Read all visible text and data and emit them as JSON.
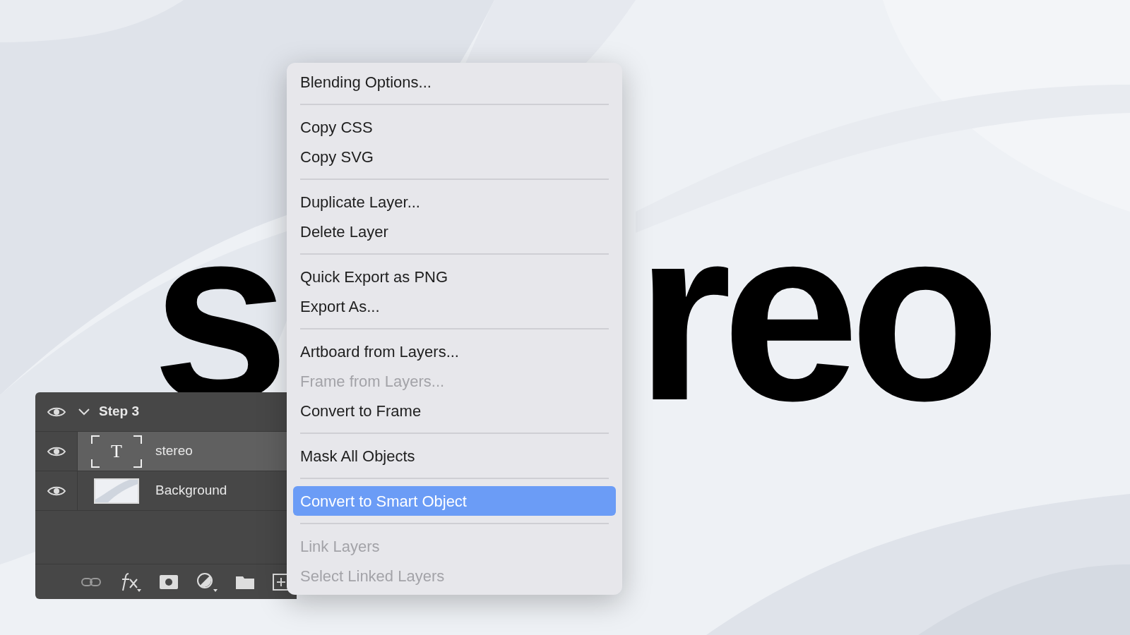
{
  "canvas": {
    "text_parts": [
      "s",
      "reo"
    ]
  },
  "layers_panel": {
    "group": {
      "name": "Step 3",
      "expanded": true,
      "visible": true
    },
    "layers": [
      {
        "name": "stereo",
        "kind": "text",
        "visible": true,
        "selected": true,
        "thumb": "T"
      },
      {
        "name": "Background",
        "visible": true,
        "selected": false
      }
    ]
  },
  "context_menu": {
    "groups": [
      [
        {
          "label": "Blending Options...",
          "disabled": false,
          "selected": false
        }
      ],
      [
        {
          "label": "Copy CSS",
          "disabled": false,
          "selected": false
        },
        {
          "label": "Copy SVG",
          "disabled": false,
          "selected": false
        }
      ],
      [
        {
          "label": "Duplicate Layer...",
          "disabled": false,
          "selected": false
        },
        {
          "label": "Delete Layer",
          "disabled": false,
          "selected": false
        }
      ],
      [
        {
          "label": "Quick Export as PNG",
          "disabled": false,
          "selected": false
        },
        {
          "label": "Export As...",
          "disabled": false,
          "selected": false
        }
      ],
      [
        {
          "label": "Artboard from Layers...",
          "disabled": false,
          "selected": false
        },
        {
          "label": "Frame from Layers...",
          "disabled": true,
          "selected": false
        },
        {
          "label": "Convert to Frame",
          "disabled": false,
          "selected": false
        }
      ],
      [
        {
          "label": "Mask All Objects",
          "disabled": false,
          "selected": false
        }
      ],
      [
        {
          "label": "Convert to Smart Object",
          "disabled": false,
          "selected": true
        }
      ],
      [
        {
          "label": "Link Layers",
          "disabled": true,
          "selected": false
        },
        {
          "label": "Select Linked Layers",
          "disabled": true,
          "selected": false
        }
      ]
    ]
  }
}
